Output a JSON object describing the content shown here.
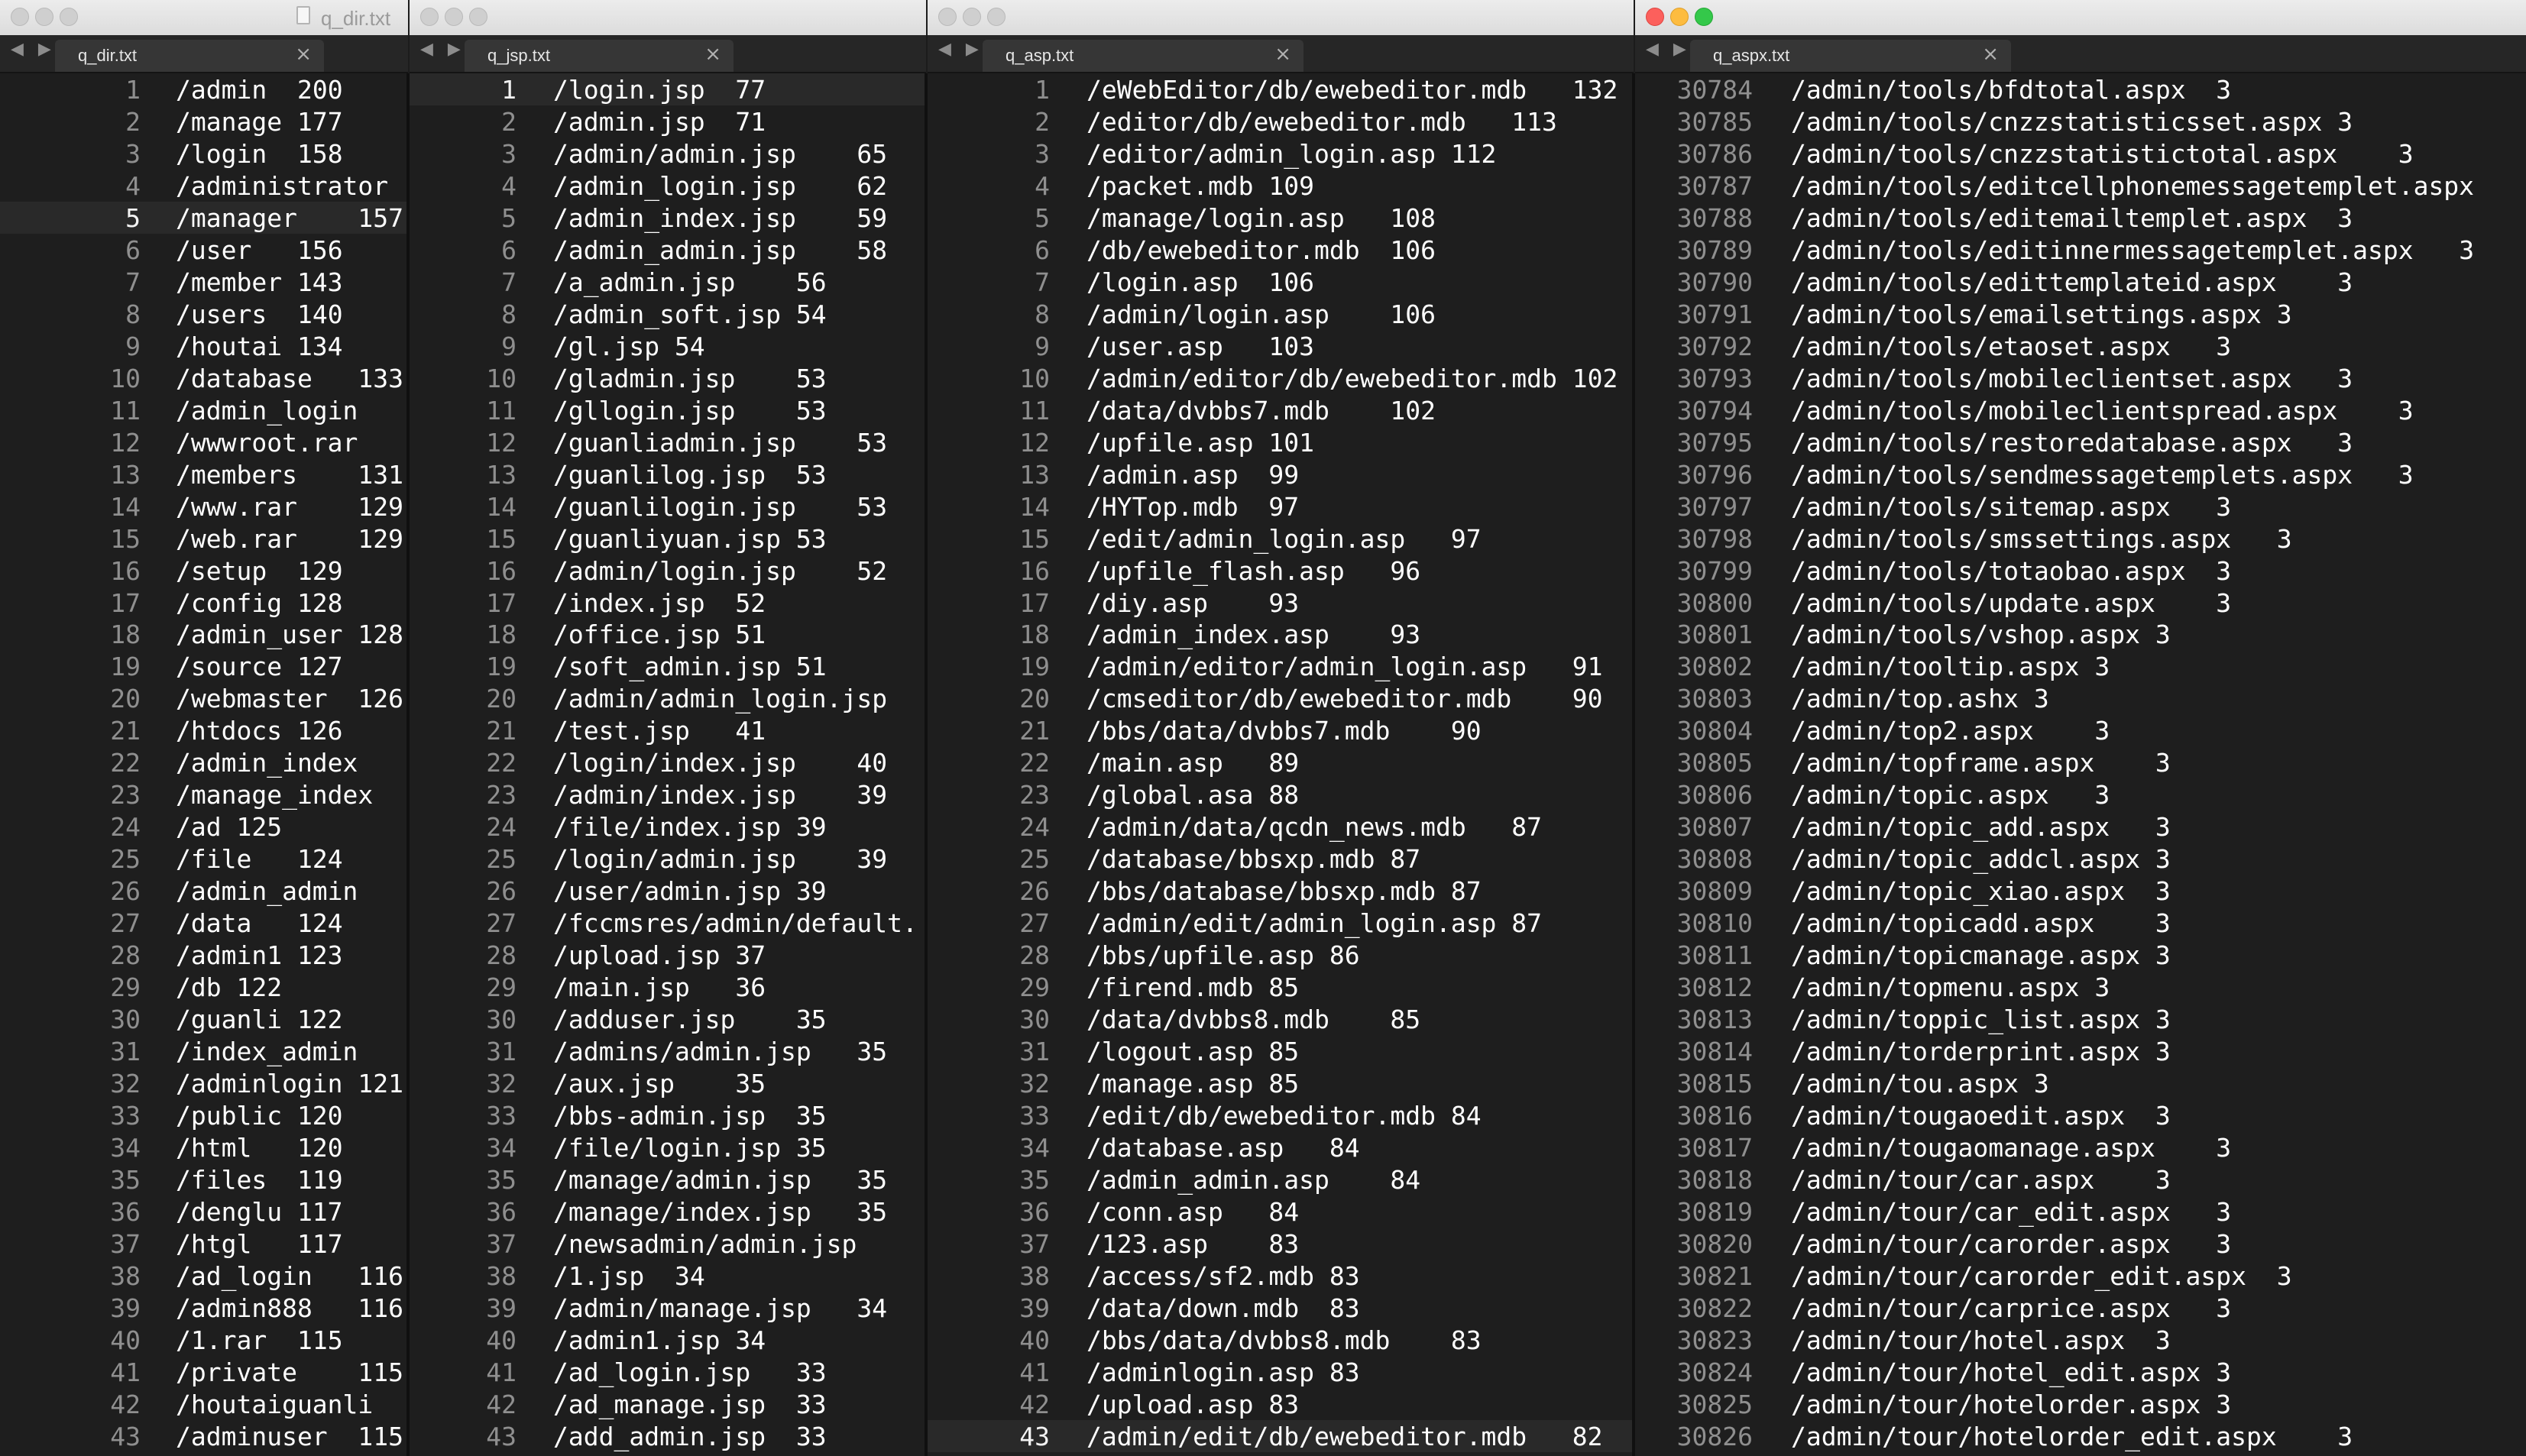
{
  "windows": [
    {
      "title": "q_dir.txt",
      "tab": "q_dir.txt",
      "active": false,
      "current_line": 5,
      "lines": [
        {
          "n": "1",
          "t": "/admin\t200"
        },
        {
          "n": "2",
          "t": "/manage\t177"
        },
        {
          "n": "3",
          "t": "/login\t158"
        },
        {
          "n": "4",
          "t": "/administrator"
        },
        {
          "n": "5",
          "t": "/manager\t157"
        },
        {
          "n": "6",
          "t": "/user\t156"
        },
        {
          "n": "7",
          "t": "/member 143"
        },
        {
          "n": "8",
          "t": "/users\t140"
        },
        {
          "n": "9",
          "t": "/houtai 134"
        },
        {
          "n": "10",
          "t": "/database\t133"
        },
        {
          "n": "11",
          "t": "/admin_login"
        },
        {
          "n": "12",
          "t": "/wwwroot.rar"
        },
        {
          "n": "13",
          "t": "/members\t131"
        },
        {
          "n": "14",
          "t": "/www.rar\t129"
        },
        {
          "n": "15",
          "t": "/web.rar\t129"
        },
        {
          "n": "16",
          "t": "/setup\t129"
        },
        {
          "n": "17",
          "t": "/config 128"
        },
        {
          "n": "18",
          "t": "/admin_user 128"
        },
        {
          "n": "19",
          "t": "/source 127"
        },
        {
          "n": "20",
          "t": "/webmaster\t126"
        },
        {
          "n": "21",
          "t": "/htdocs 126"
        },
        {
          "n": "22",
          "t": "/admin_index"
        },
        {
          "n": "23",
          "t": "/manage_index"
        },
        {
          "n": "24",
          "t": "/ad 125"
        },
        {
          "n": "25",
          "t": "/file\t124"
        },
        {
          "n": "26",
          "t": "/admin_admin"
        },
        {
          "n": "27",
          "t": "/data\t124"
        },
        {
          "n": "28",
          "t": "/admin1 123"
        },
        {
          "n": "29",
          "t": "/db 122"
        },
        {
          "n": "30",
          "t": "/guanli 122"
        },
        {
          "n": "31",
          "t": "/index_admin"
        },
        {
          "n": "32",
          "t": "/adminlogin 121"
        },
        {
          "n": "33",
          "t": "/public 120"
        },
        {
          "n": "34",
          "t": "/html\t120"
        },
        {
          "n": "35",
          "t": "/files\t119"
        },
        {
          "n": "36",
          "t": "/denglu 117"
        },
        {
          "n": "37",
          "t": "/htgl\t117"
        },
        {
          "n": "38",
          "t": "/ad_login\t116"
        },
        {
          "n": "39",
          "t": "/admin888\t116"
        },
        {
          "n": "40",
          "t": "/1.rar\t115"
        },
        {
          "n": "41",
          "t": "/private\t115"
        },
        {
          "n": "42",
          "t": "/houtaiguanli"
        },
        {
          "n": "43",
          "t": "/adminuser\t115"
        }
      ]
    },
    {
      "title": "",
      "tab": "q_jsp.txt",
      "active": false,
      "current_line": 1,
      "lines": [
        {
          "n": "1",
          "t": "/login.jsp\t77"
        },
        {
          "n": "2",
          "t": "/admin.jsp\t71"
        },
        {
          "n": "3",
          "t": "/admin/admin.jsp\t65"
        },
        {
          "n": "4",
          "t": "/admin_login.jsp\t62"
        },
        {
          "n": "5",
          "t": "/admin_index.jsp\t59"
        },
        {
          "n": "6",
          "t": "/admin_admin.jsp\t58"
        },
        {
          "n": "7",
          "t": "/a_admin.jsp\t56"
        },
        {
          "n": "8",
          "t": "/admin_soft.jsp 54"
        },
        {
          "n": "9",
          "t": "/gl.jsp 54"
        },
        {
          "n": "10",
          "t": "/gladmin.jsp\t53"
        },
        {
          "n": "11",
          "t": "/gllogin.jsp\t53"
        },
        {
          "n": "12",
          "t": "/guanliadmin.jsp\t53"
        },
        {
          "n": "13",
          "t": "/guanlilog.jsp\t53"
        },
        {
          "n": "14",
          "t": "/guanlilogin.jsp\t53"
        },
        {
          "n": "15",
          "t": "/guanliyuan.jsp 53"
        },
        {
          "n": "16",
          "t": "/admin/login.jsp\t52"
        },
        {
          "n": "17",
          "t": "/index.jsp\t52"
        },
        {
          "n": "18",
          "t": "/office.jsp 51"
        },
        {
          "n": "19",
          "t": "/soft_admin.jsp 51"
        },
        {
          "n": "20",
          "t": "/admin/admin_login.jsp"
        },
        {
          "n": "21",
          "t": "/test.jsp\t41"
        },
        {
          "n": "22",
          "t": "/login/index.jsp\t40"
        },
        {
          "n": "23",
          "t": "/admin/index.jsp\t39"
        },
        {
          "n": "24",
          "t": "/file/index.jsp 39"
        },
        {
          "n": "25",
          "t": "/login/admin.jsp\t39"
        },
        {
          "n": "26",
          "t": "/user/admin.jsp 39"
        },
        {
          "n": "27",
          "t": "/fccmsres/admin/default."
        },
        {
          "n": "28",
          "t": "/upload.jsp 37"
        },
        {
          "n": "29",
          "t": "/main.jsp\t36"
        },
        {
          "n": "30",
          "t": "/adduser.jsp\t35"
        },
        {
          "n": "31",
          "t": "/admins/admin.jsp\t35"
        },
        {
          "n": "32",
          "t": "/aux.jsp\t35"
        },
        {
          "n": "33",
          "t": "/bbs-admin.jsp\t35"
        },
        {
          "n": "34",
          "t": "/file/login.jsp 35"
        },
        {
          "n": "35",
          "t": "/manage/admin.jsp\t35"
        },
        {
          "n": "36",
          "t": "/manage/index.jsp\t35"
        },
        {
          "n": "37",
          "t": "/newsadmin/admin.jsp"
        },
        {
          "n": "38",
          "t": "/1.jsp\t34"
        },
        {
          "n": "39",
          "t": "/admin/manage.jsp\t34"
        },
        {
          "n": "40",
          "t": "/admin1.jsp 34"
        },
        {
          "n": "41",
          "t": "/ad_login.jsp\t33"
        },
        {
          "n": "42",
          "t": "/ad_manage.jsp\t33"
        },
        {
          "n": "43",
          "t": "/add_admin.jsp\t33"
        }
      ]
    },
    {
      "title": "",
      "tab": "q_asp.txt",
      "active": false,
      "current_line": 43,
      "lines": [
        {
          "n": "1",
          "t": "/eWebEditor/db/ewebeditor.mdb\t132"
        },
        {
          "n": "2",
          "t": "/editor/db/ewebeditor.mdb\t113"
        },
        {
          "n": "3",
          "t": "/editor/admin_login.asp 112"
        },
        {
          "n": "4",
          "t": "/packet.mdb 109"
        },
        {
          "n": "5",
          "t": "/manage/login.asp\t108"
        },
        {
          "n": "6",
          "t": "/db/ewebeditor.mdb\t106"
        },
        {
          "n": "7",
          "t": "/login.asp\t106"
        },
        {
          "n": "8",
          "t": "/admin/login.asp\t106"
        },
        {
          "n": "9",
          "t": "/user.asp\t103"
        },
        {
          "n": "10",
          "t": "/admin/editor/db/ewebeditor.mdb 102"
        },
        {
          "n": "11",
          "t": "/data/dvbbs7.mdb\t102"
        },
        {
          "n": "12",
          "t": "/upfile.asp 101"
        },
        {
          "n": "13",
          "t": "/admin.asp\t99"
        },
        {
          "n": "14",
          "t": "/HYTop.mdb\t97"
        },
        {
          "n": "15",
          "t": "/edit/admin_login.asp\t97"
        },
        {
          "n": "16",
          "t": "/upfile_flash.asp\t96"
        },
        {
          "n": "17",
          "t": "/diy.asp\t93"
        },
        {
          "n": "18",
          "t": "/admin_index.asp\t93"
        },
        {
          "n": "19",
          "t": "/admin/editor/admin_login.asp\t91"
        },
        {
          "n": "20",
          "t": "/cmseditor/db/ewebeditor.mdb\t90"
        },
        {
          "n": "21",
          "t": "/bbs/data/dvbbs7.mdb\t90"
        },
        {
          "n": "22",
          "t": "/main.asp\t89"
        },
        {
          "n": "23",
          "t": "/global.asa 88"
        },
        {
          "n": "24",
          "t": "/admin/data/qcdn_news.mdb\t87"
        },
        {
          "n": "25",
          "t": "/database/bbsxp.mdb 87"
        },
        {
          "n": "26",
          "t": "/bbs/database/bbsxp.mdb 87"
        },
        {
          "n": "27",
          "t": "/admin/edit/admin_login.asp 87"
        },
        {
          "n": "28",
          "t": "/bbs/upfile.asp 86"
        },
        {
          "n": "29",
          "t": "/firend.mdb 85"
        },
        {
          "n": "30",
          "t": "/data/dvbbs8.mdb\t85"
        },
        {
          "n": "31",
          "t": "/logout.asp 85"
        },
        {
          "n": "32",
          "t": "/manage.asp 85"
        },
        {
          "n": "33",
          "t": "/edit/db/ewebeditor.mdb 84"
        },
        {
          "n": "34",
          "t": "/database.asp\t84"
        },
        {
          "n": "35",
          "t": "/admin_admin.asp\t84"
        },
        {
          "n": "36",
          "t": "/conn.asp\t84"
        },
        {
          "n": "37",
          "t": "/123.asp\t83"
        },
        {
          "n": "38",
          "t": "/access/sf2.mdb 83"
        },
        {
          "n": "39",
          "t": "/data/down.mdb\t83"
        },
        {
          "n": "40",
          "t": "/bbs/data/dvbbs8.mdb\t83"
        },
        {
          "n": "41",
          "t": "/adminlogin.asp 83"
        },
        {
          "n": "42",
          "t": "/upload.asp 83"
        },
        {
          "n": "43",
          "t": "/admin/edit/db/ewebeditor.mdb\t82"
        }
      ]
    },
    {
      "title": "",
      "tab": "q_aspx.txt",
      "active": true,
      "current_line": 0,
      "lines": [
        {
          "n": "30784",
          "t": "/admin/tools/bfdtotal.aspx\t3"
        },
        {
          "n": "30785",
          "t": "/admin/tools/cnzzstatisticsset.aspx 3"
        },
        {
          "n": "30786",
          "t": "/admin/tools/cnzzstatistictotal.aspx\t3"
        },
        {
          "n": "30787",
          "t": "/admin/tools/editcellphonemessagetemplet.aspx"
        },
        {
          "n": "30788",
          "t": "/admin/tools/editemailtemplet.aspx\t3"
        },
        {
          "n": "30789",
          "t": "/admin/tools/editinnermessagetemplet.aspx\t3"
        },
        {
          "n": "30790",
          "t": "/admin/tools/edittemplateid.aspx\t3"
        },
        {
          "n": "30791",
          "t": "/admin/tools/emailsettings.aspx 3"
        },
        {
          "n": "30792",
          "t": "/admin/tools/etaoset.aspx\t3"
        },
        {
          "n": "30793",
          "t": "/admin/tools/mobileclientset.aspx\t3"
        },
        {
          "n": "30794",
          "t": "/admin/tools/mobileclientspread.aspx\t3"
        },
        {
          "n": "30795",
          "t": "/admin/tools/restoredatabase.aspx\t3"
        },
        {
          "n": "30796",
          "t": "/admin/tools/sendmessagetemplets.aspx\t3"
        },
        {
          "n": "30797",
          "t": "/admin/tools/sitemap.aspx\t3"
        },
        {
          "n": "30798",
          "t": "/admin/tools/smssettings.aspx\t3"
        },
        {
          "n": "30799",
          "t": "/admin/tools/totaobao.aspx\t3"
        },
        {
          "n": "30800",
          "t": "/admin/tools/update.aspx\t3"
        },
        {
          "n": "30801",
          "t": "/admin/tools/vshop.aspx 3"
        },
        {
          "n": "30802",
          "t": "/admin/tooltip.aspx 3"
        },
        {
          "n": "30803",
          "t": "/admin/top.ashx 3"
        },
        {
          "n": "30804",
          "t": "/admin/top2.aspx\t3"
        },
        {
          "n": "30805",
          "t": "/admin/topframe.aspx\t3"
        },
        {
          "n": "30806",
          "t": "/admin/topic.aspx\t3"
        },
        {
          "n": "30807",
          "t": "/admin/topic_add.aspx\t3"
        },
        {
          "n": "30808",
          "t": "/admin/topic_addcl.aspx 3"
        },
        {
          "n": "30809",
          "t": "/admin/topic_xiao.aspx\t3"
        },
        {
          "n": "30810",
          "t": "/admin/topicadd.aspx\t3"
        },
        {
          "n": "30811",
          "t": "/admin/topicmanage.aspx 3"
        },
        {
          "n": "30812",
          "t": "/admin/topmenu.aspx 3"
        },
        {
          "n": "30813",
          "t": "/admin/toppic_list.aspx 3"
        },
        {
          "n": "30814",
          "t": "/admin/torderprint.aspx 3"
        },
        {
          "n": "30815",
          "t": "/admin/tou.aspx 3"
        },
        {
          "n": "30816",
          "t": "/admin/tougaoedit.aspx\t3"
        },
        {
          "n": "30817",
          "t": "/admin/tougaomanage.aspx\t3"
        },
        {
          "n": "30818",
          "t": "/admin/tour/car.aspx\t3"
        },
        {
          "n": "30819",
          "t": "/admin/tour/car_edit.aspx\t3"
        },
        {
          "n": "30820",
          "t": "/admin/tour/carorder.aspx\t3"
        },
        {
          "n": "30821",
          "t": "/admin/tour/carorder_edit.aspx\t3"
        },
        {
          "n": "30822",
          "t": "/admin/tour/carprice.aspx\t3"
        },
        {
          "n": "30823",
          "t": "/admin/tour/hotel.aspx\t3"
        },
        {
          "n": "30824",
          "t": "/admin/tour/hotel_edit.aspx 3"
        },
        {
          "n": "30825",
          "t": "/admin/tour/hotelorder.aspx 3"
        },
        {
          "n": "30826",
          "t": "/admin/tour/hotelorder_edit.aspx\t3"
        }
      ]
    }
  ],
  "nav_arrows": "◀ ▶",
  "close_glyph": "×"
}
